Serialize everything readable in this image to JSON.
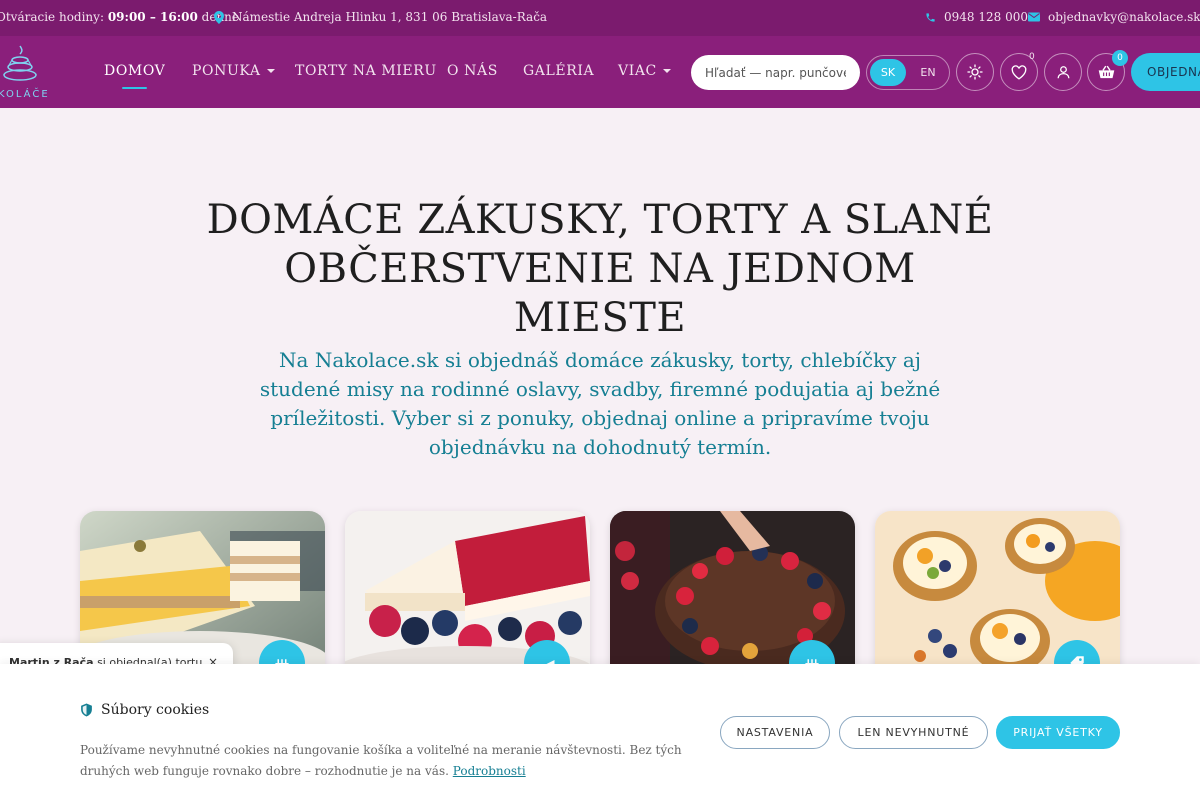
{
  "topbar": {
    "hours_label": "Otváracie hodiny:",
    "hours_time": "09:00 – 16:00",
    "hours_suffix": "denne",
    "address": "Námestie Andreja Hlinku 1, 831 06 Bratislava-Rača",
    "phone": "0948 128 000",
    "email": "objednavky@nakolace.sk"
  },
  "logo": {
    "text": "KOLÁČE"
  },
  "nav": {
    "items": [
      {
        "label": "DOMOV",
        "active": true
      },
      {
        "label": "PONUKA",
        "dropdown": true
      },
      {
        "label": "TORTY NA MIERU"
      },
      {
        "label": "O NÁS"
      },
      {
        "label": "GALÉRIA"
      },
      {
        "label": "VIAC",
        "dropdown": true
      }
    ],
    "search_placeholder": "Hľadať — napr. punčové",
    "lang": [
      "SK",
      "EN"
    ],
    "wishlist_count": "0",
    "cart_count": "0",
    "order_label": "OBJEDNAŤ"
  },
  "hero": {
    "title": "DOMÁCE ZÁKUSKY, TORTY A SLANÉ OBČERSTVENIE NA JEDNOM MIESTE",
    "subtitle": "Na Nakolace.sk si objednáš domáce zákusky, torty, chlebíčky aj studené misy na rodinné oslavy, svadby, firemné podujatia aj bežné príležitosti. Vyber si z ponuky, objednaj online a pripravíme tvoju objednávku na dohodnutý termín."
  },
  "toast": {
    "name": "Martin z Rača",
    "text": "si objednal(a) tortu",
    "close": "×"
  },
  "cookie": {
    "title": "Súbory cookies",
    "description": "Používame nevyhnutné cookies na fungovanie košíka a voliteľné na meranie návštevnosti. Bez tých druhých web funguje rovnako dobre – rozhodnutie je na vás.",
    "link": "Podrobnosti",
    "settings": "NASTAVENIA",
    "necessary": "LEN NEVYHNUTNÉ",
    "accept": "PRIJAŤ VŠETKY"
  },
  "colors": {
    "brand_purple": "#8a1f7b",
    "accent_cyan": "#2ec4e6",
    "text_teal": "#167f93"
  }
}
